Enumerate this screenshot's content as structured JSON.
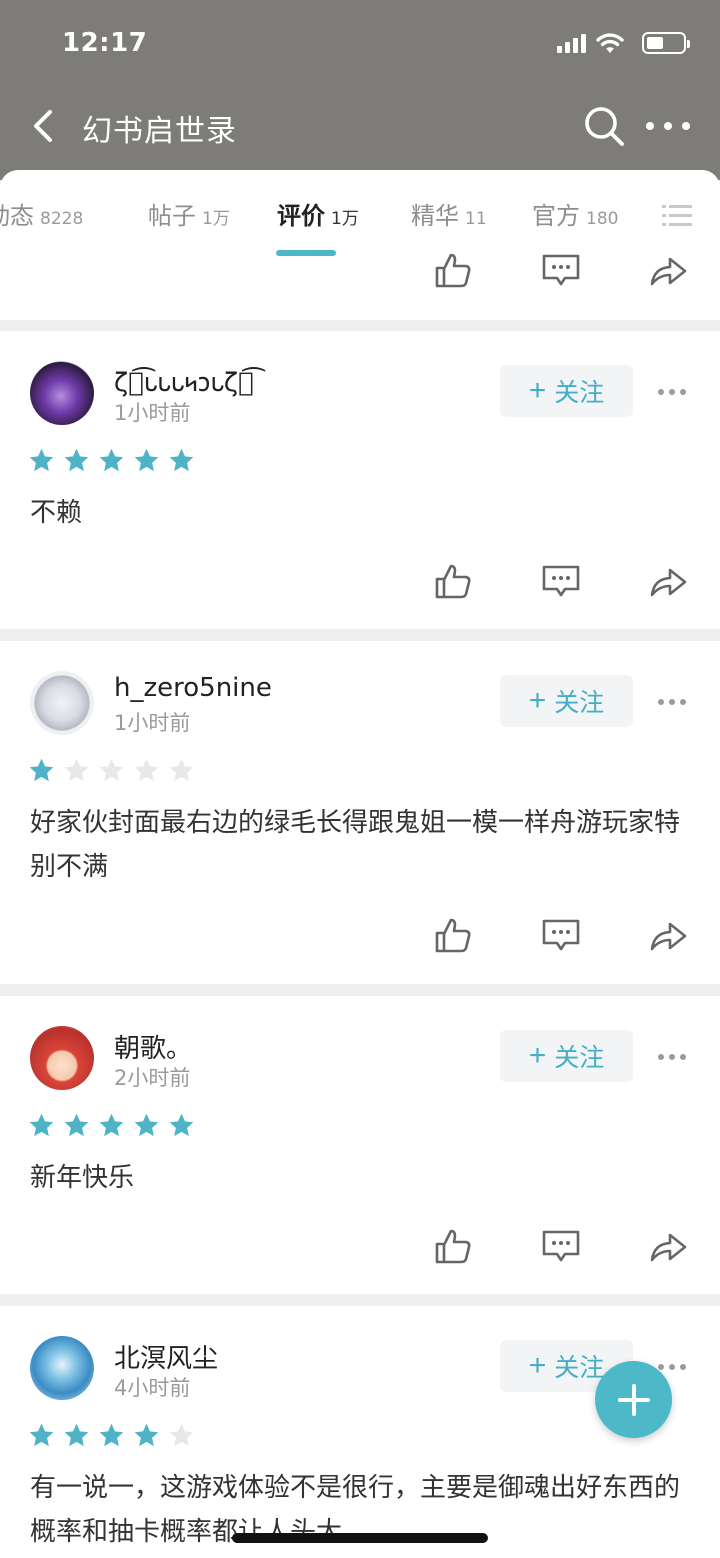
{
  "status": {
    "time": "12:17"
  },
  "nav": {
    "title": "幻书启世录"
  },
  "tabs": [
    {
      "label": "动态",
      "count": "8228"
    },
    {
      "label": "帖子",
      "count": "1万"
    },
    {
      "label": "评价",
      "count": "1万"
    },
    {
      "label": "精华",
      "count": "11"
    },
    {
      "label": "官方",
      "count": "180"
    }
  ],
  "reviews": [
    {
      "user": "ζั͡𐑊𐑊𐑊𐑌𐑋𐑊ζั͡",
      "time": "1小时前",
      "rating": 5,
      "text": "不赖",
      "follow": "关注"
    },
    {
      "user": "h_zero5nine",
      "time": "1小时前",
      "rating": 1,
      "text": "好家伙封面最右边的绿毛长得跟鬼姐一模一样舟游玩家特别不满",
      "follow": "关注"
    },
    {
      "user": "朝歌。",
      "time": "2小时前",
      "rating": 5,
      "text": "新年快乐",
      "follow": "关注"
    },
    {
      "user": "北溟风尘",
      "time": "4小时前",
      "rating": 4,
      "text": "有一说一，这游戏体验不是很行，主要是御魂出好东西的概率和抽卡概率都让人头大",
      "follow": "关注"
    }
  ],
  "colors": {
    "accent": "#4eb7c6",
    "star_on": "#4fb3c8",
    "star_off": "#e6e8ea",
    "header_bg": "#7d7c78"
  },
  "icons": [
    "back-icon",
    "search-icon",
    "more-icon",
    "list-icon",
    "like-icon",
    "comment-icon",
    "share-icon",
    "plus-icon"
  ]
}
